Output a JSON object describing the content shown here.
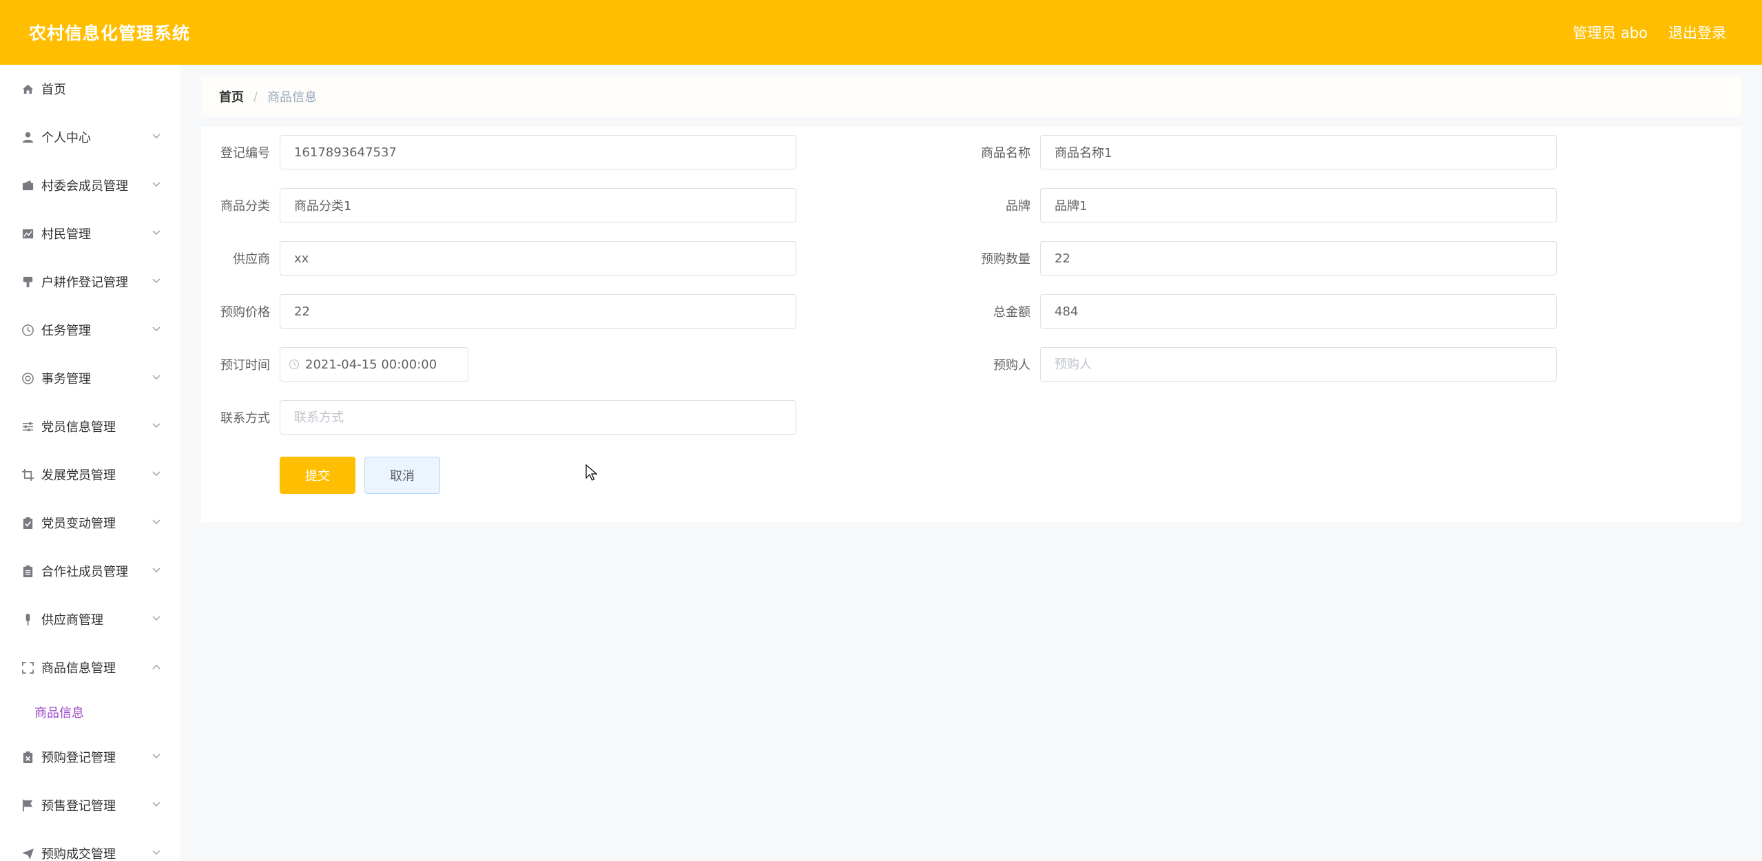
{
  "header": {
    "title": "农村信息化管理系统",
    "user_label": "管理员 abo",
    "logout_label": "退出登录"
  },
  "sidebar": {
    "items": [
      {
        "label": "首页",
        "icon": "home-icon",
        "has_chevron": false
      },
      {
        "label": "个人中心",
        "icon": "user-icon",
        "has_chevron": true
      },
      {
        "label": "村委会成员管理",
        "icon": "wallet-icon",
        "has_chevron": true
      },
      {
        "label": "村民管理",
        "icon": "chart-icon",
        "has_chevron": true
      },
      {
        "label": "户耕作登记管理",
        "icon": "brush-icon",
        "has_chevron": true
      },
      {
        "label": "任务管理",
        "icon": "clock-icon",
        "has_chevron": true
      },
      {
        "label": "事务管理",
        "icon": "lifebuoy-icon",
        "has_chevron": true
      },
      {
        "label": "党员信息管理",
        "icon": "sliders-icon",
        "has_chevron": true
      },
      {
        "label": "发展党员管理",
        "icon": "crop-icon",
        "has_chevron": true
      },
      {
        "label": "党员变动管理",
        "icon": "clipboard-check-icon",
        "has_chevron": true
      },
      {
        "label": "合作社成员管理",
        "icon": "clipboard-icon",
        "has_chevron": true
      },
      {
        "label": "供应商管理",
        "icon": "microphone-icon",
        "has_chevron": true
      },
      {
        "label": "商品信息管理",
        "icon": "fullscreen-icon",
        "has_chevron": true,
        "expanded": true
      },
      {
        "label": "预购登记管理",
        "icon": "clipboard-x-icon",
        "has_chevron": true
      },
      {
        "label": "预售登记管理",
        "icon": "flag-icon",
        "has_chevron": true
      },
      {
        "label": "预购成交管理",
        "icon": "send-icon",
        "has_chevron": true
      }
    ],
    "submenu": {
      "label": "商品信息"
    }
  },
  "breadcrumb": {
    "home": "首页",
    "separator": "/",
    "current": "商品信息"
  },
  "form": {
    "fields": {
      "reg_no": {
        "label": "登记编号",
        "value": "1617893647537",
        "placeholder": ""
      },
      "product_name": {
        "label": "商品名称",
        "value": "商品名称1",
        "placeholder": ""
      },
      "category": {
        "label": "商品分类",
        "value": "商品分类1",
        "placeholder": ""
      },
      "brand": {
        "label": "品牌",
        "value": "品牌1",
        "placeholder": ""
      },
      "supplier": {
        "label": "供应商",
        "value": "xx",
        "placeholder": ""
      },
      "quantity": {
        "label": "预购数量",
        "value": "22",
        "placeholder": ""
      },
      "price": {
        "label": "预购价格",
        "value": "22",
        "placeholder": ""
      },
      "total": {
        "label": "总金额",
        "value": "484",
        "placeholder": ""
      },
      "order_time": {
        "label": "预订时间",
        "value": "2021-04-15 00:00:00"
      },
      "buyer": {
        "label": "预购人",
        "value": "",
        "placeholder": "预购人"
      },
      "contact": {
        "label": "联系方式",
        "value": "",
        "placeholder": "联系方式"
      }
    },
    "submit_label": "提交",
    "cancel_label": "取消"
  },
  "colors": {
    "brand": "#ffbf00",
    "submenu_active": "#9a48c7",
    "cancel_bg": "#ecf5ff"
  }
}
